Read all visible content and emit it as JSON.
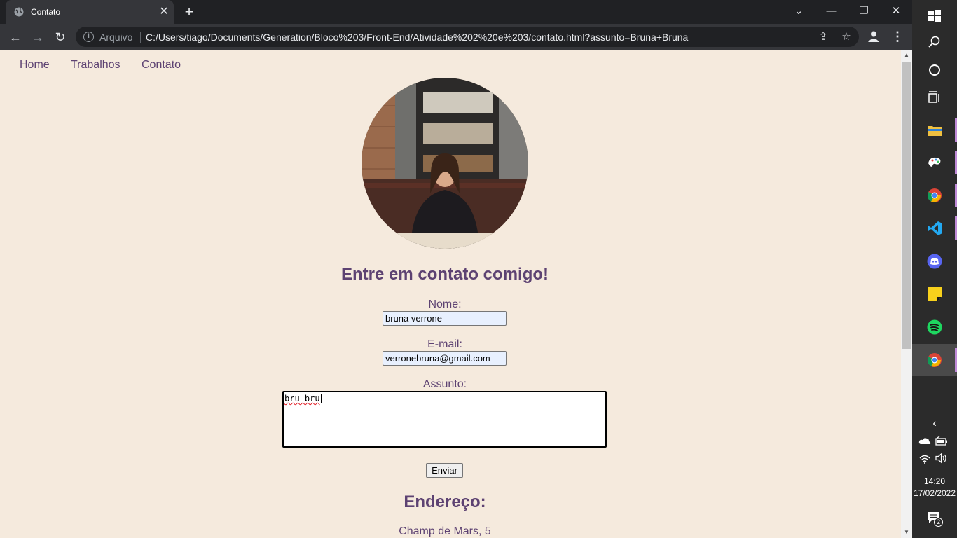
{
  "browser": {
    "tab_title": "Contato",
    "security_label": "Arquivo",
    "url": "C:/Users/tiago/Documents/Generation/Bloco%203/Front-End/Atividade%202%20e%203/contato.html?assunto=Bruna+Bruna"
  },
  "nav": {
    "links": [
      "Home",
      "Trabalhos",
      "Contato"
    ]
  },
  "page": {
    "heading": "Entre em contato comigo!",
    "form": {
      "name_label": "Nome:",
      "name_value": "bruna verrone",
      "email_label": "E-mail:",
      "email_value": "verronebruna@gmail.com",
      "subject_label": "Assunto:",
      "subject_value": "bru bru",
      "submit_label": "Enviar"
    },
    "address_heading": "Endereço:",
    "address_line": "Champ de Mars, 5"
  },
  "taskbar": {
    "time": "14:20",
    "date": "17/02/2022",
    "notification_count": "2",
    "pinned": [
      "start-icon",
      "search-icon",
      "cortana-icon",
      "task-view-icon",
      "file-explorer-icon",
      "paint-icon",
      "chrome-icon",
      "vscode-icon",
      "discord-icon",
      "sticky-notes-icon",
      "spotify-icon",
      "chrome-icon"
    ]
  },
  "colors": {
    "page_background": "#f5eadd",
    "accent_purple": "#5d4272",
    "chrome_dark": "#202124",
    "chrome_toolbar": "#35363a"
  }
}
